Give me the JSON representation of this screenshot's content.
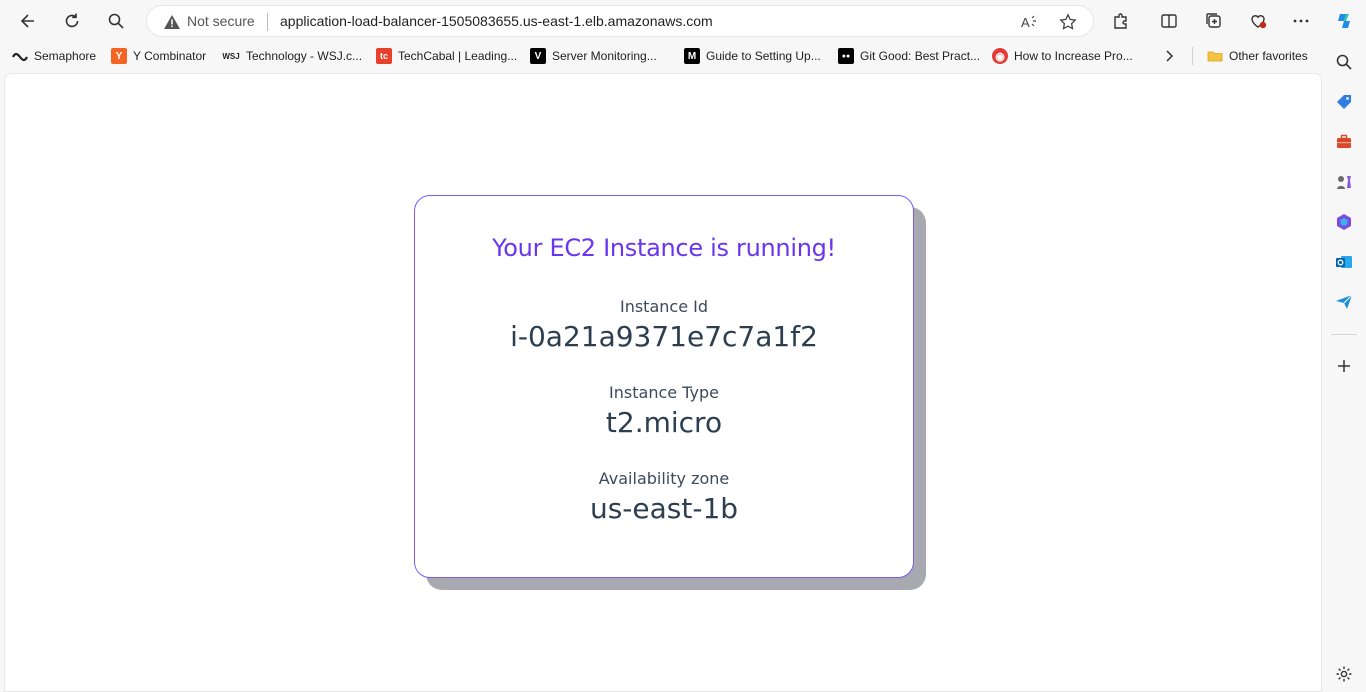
{
  "browser": {
    "security_label": "Not secure",
    "url": "application-load-balancer-1505083655.us-east-1.elb.amazonaws.com"
  },
  "favorites": [
    {
      "label": "Semaphore",
      "icon": "semaphore-icon"
    },
    {
      "label": "Y Combinator",
      "icon": "y-combinator-icon",
      "glyph": "Y",
      "color": "#f26522"
    },
    {
      "label": "Technology - WSJ.c...",
      "icon": "wsj-icon",
      "glyph": "WSJ"
    },
    {
      "label": "TechCabal | Leading...",
      "icon": "techcabal-icon",
      "glyph": "tc",
      "color": "#e8402a"
    },
    {
      "label": "Server Monitoring...",
      "icon": "vercel-v-icon",
      "glyph": "V",
      "color": "#000000"
    },
    {
      "label": "Guide to Setting Up...",
      "icon": "medium-icon",
      "glyph": "M",
      "color": "#000000"
    },
    {
      "label": "Git Good: Best Pract...",
      "icon": "medium-dots-icon",
      "glyph": "●●",
      "color": "#000000"
    },
    {
      "label": "How to Increase Pro...",
      "icon": "red-circle-icon",
      "glyph": "◉",
      "color": "#e53935"
    }
  ],
  "other_favorites": "Other favorites",
  "card": {
    "title": "Your EC2 Instance is running!",
    "instance_id_label": "Instance Id",
    "instance_id": "i-0a21a9371e7c7a1f2",
    "instance_type_label": "Instance Type",
    "instance_type": "t2.micro",
    "az_label": "Availability zone",
    "az": "us-east-1b"
  },
  "colors": {
    "title": "#6a35f0",
    "card_border": "#7b5cf0",
    "text": "#2c3e50"
  }
}
